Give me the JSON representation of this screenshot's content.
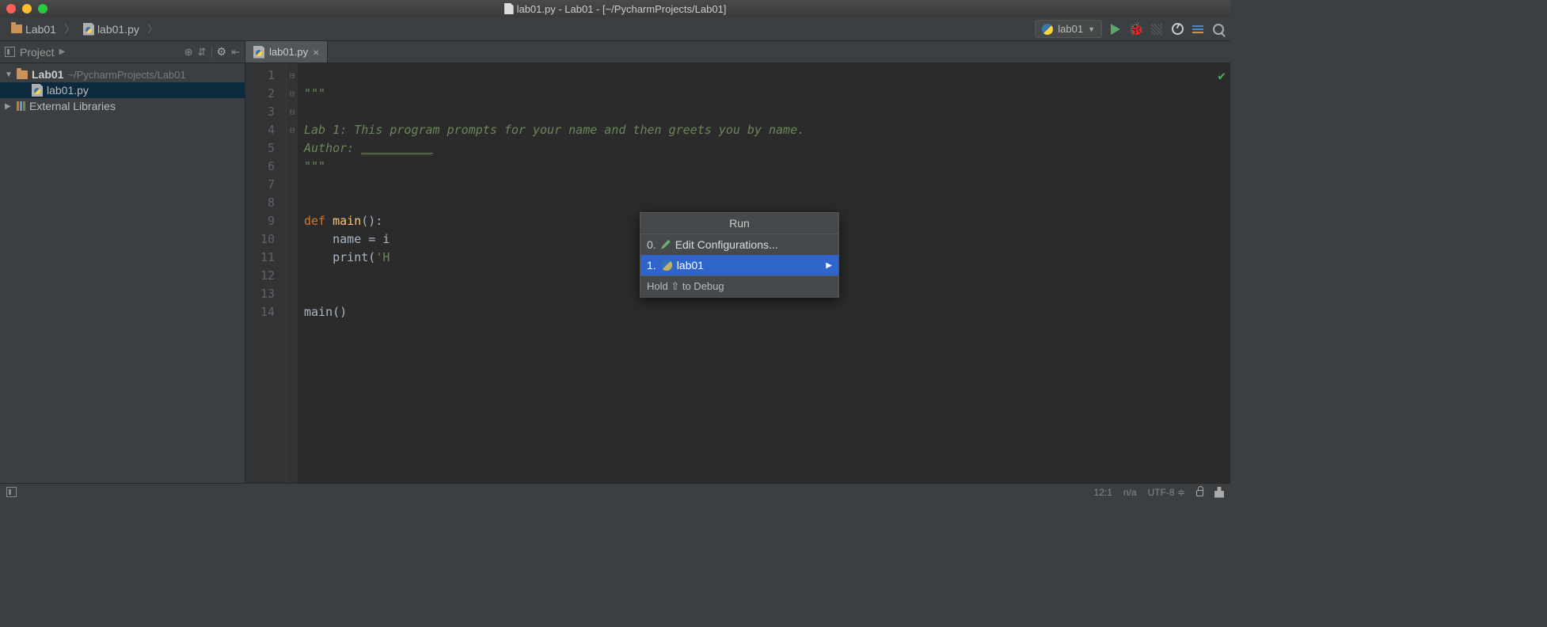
{
  "window": {
    "title": "lab01.py - Lab01 - [~/PycharmProjects/Lab01]"
  },
  "breadcrumb": {
    "project": "Lab01",
    "file": "lab01.py"
  },
  "toolbar": {
    "config_name": "lab01"
  },
  "sidebar": {
    "title": "Project",
    "root": "Lab01",
    "root_path": "~/PycharmProjects/Lab01",
    "file": "lab01.py",
    "external": "External Libraries"
  },
  "tab": {
    "name": "lab01.py"
  },
  "code": {
    "lines": [
      "1",
      "2",
      "3",
      "4",
      "5",
      "6",
      "7",
      "8",
      "9",
      "10",
      "11",
      "12",
      "13",
      "14"
    ],
    "l1": "\"\"\"",
    "l2": "",
    "l3": "Lab 1: This program prompts for your name and then greets you by name.",
    "l4a": "Author: ",
    "l4b": "__________",
    "l5": "\"\"\"",
    "l8_def": "def ",
    "l8_fn": "main",
    "l8_rest": "():",
    "l9a": "    name = i",
    "l10a": "    ",
    "l10b": "print",
    "l10c": "(",
    "l10d": "'H",
    "l13": "main()"
  },
  "popup": {
    "title": "Run",
    "item0_num": "0.",
    "item0": "Edit Configurations...",
    "item1_num": "1.",
    "item1": "lab01",
    "hint": "Hold ⇧ to Debug"
  },
  "status": {
    "pos": "12:1",
    "na": "n/a",
    "enc": "UTF-8",
    "div": "≑"
  }
}
